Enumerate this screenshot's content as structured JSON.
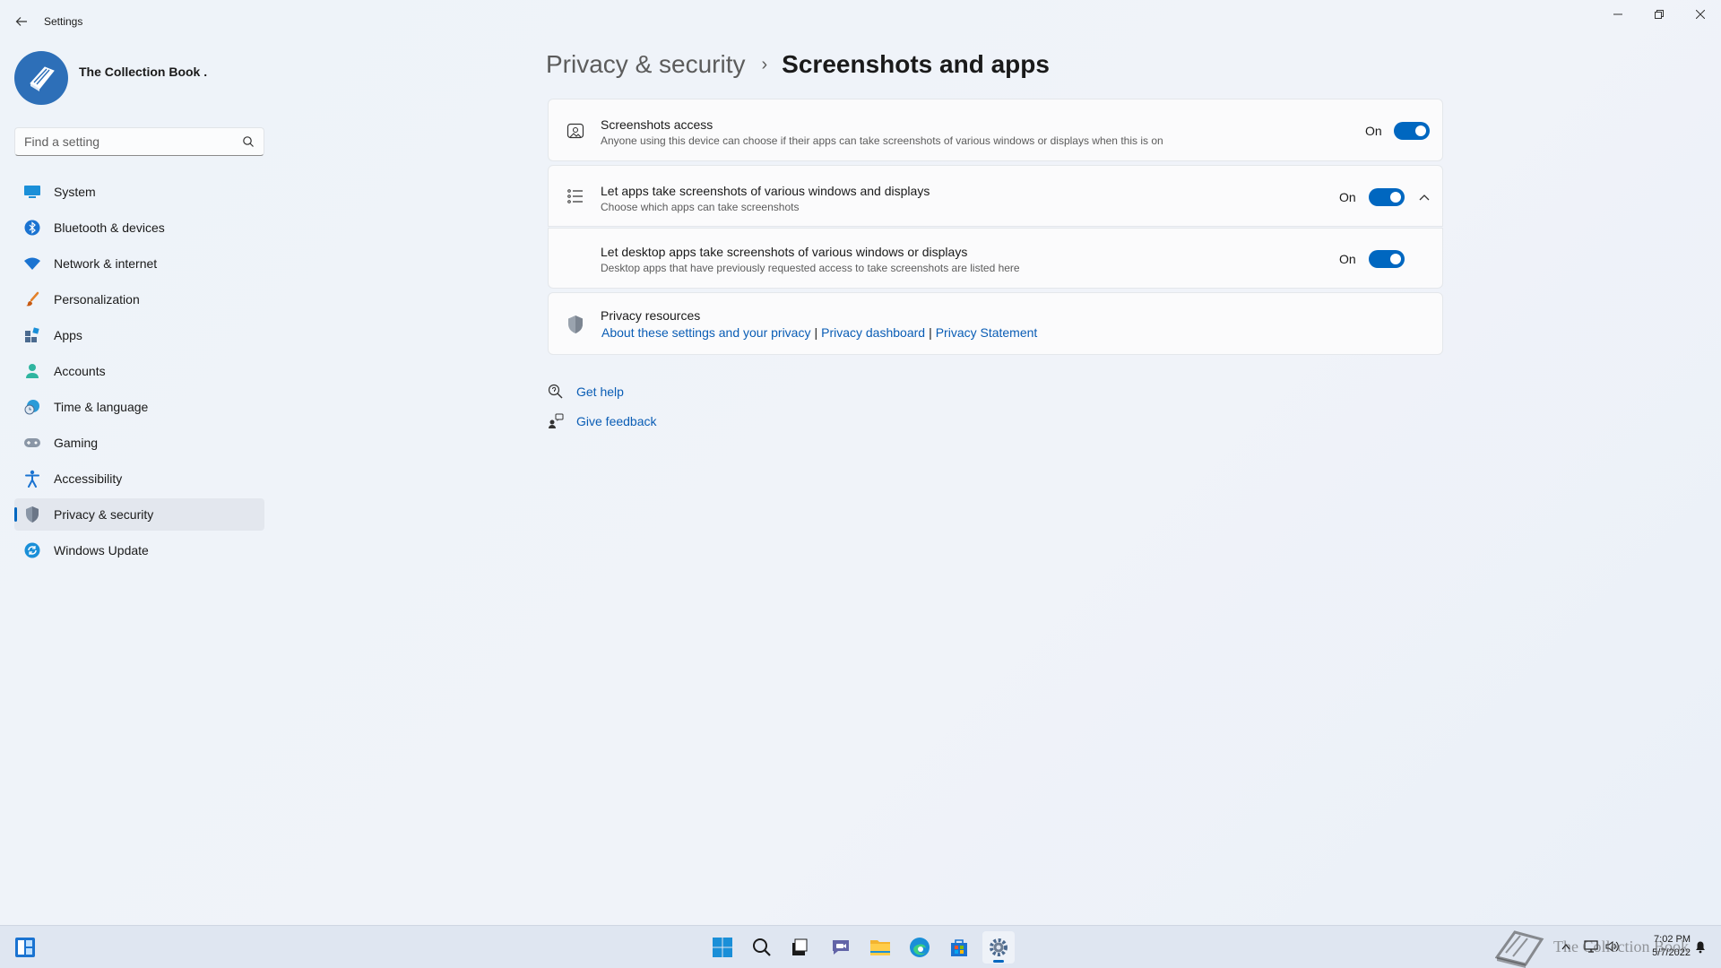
{
  "window": {
    "title": "Settings",
    "controls": {
      "minimize": "minimize",
      "maximize": "restore",
      "close": "close"
    }
  },
  "profile": {
    "name": "The Collection Book ."
  },
  "search": {
    "placeholder": "Find a setting"
  },
  "sidebar": {
    "items": [
      {
        "label": "System",
        "icon": "system-icon",
        "active": false
      },
      {
        "label": "Bluetooth & devices",
        "icon": "bluetooth-icon",
        "active": false
      },
      {
        "label": "Network & internet",
        "icon": "wifi-icon",
        "active": false
      },
      {
        "label": "Personalization",
        "icon": "brush-icon",
        "active": false
      },
      {
        "label": "Apps",
        "icon": "apps-icon",
        "active": false
      },
      {
        "label": "Accounts",
        "icon": "person-icon",
        "active": false
      },
      {
        "label": "Time & language",
        "icon": "globe-clock-icon",
        "active": false
      },
      {
        "label": "Gaming",
        "icon": "gamepad-icon",
        "active": false
      },
      {
        "label": "Accessibility",
        "icon": "accessibility-icon",
        "active": false
      },
      {
        "label": "Privacy & security",
        "icon": "shield-icon",
        "active": true
      },
      {
        "label": "Windows Update",
        "icon": "update-icon",
        "active": false
      }
    ]
  },
  "header": {
    "parent": "Privacy & security",
    "separator": "›",
    "current": "Screenshots and apps"
  },
  "settings": {
    "screenshots_access": {
      "title": "Screenshots access",
      "description": "Anyone using this device can choose if their apps can take screenshots of various windows or displays when this is on",
      "state": "On",
      "enabled": true
    },
    "let_apps": {
      "title": "Let apps take screenshots of various windows and displays",
      "description": "Choose which apps can take screenshots",
      "state": "On",
      "enabled": true,
      "expanded": true
    },
    "desktop_apps": {
      "title": "Let desktop apps take screenshots of various windows or displays",
      "description": "Desktop apps that have previously requested access to take screenshots are listed here",
      "state": "On",
      "enabled": true
    }
  },
  "privacy_resources": {
    "title": "Privacy resources",
    "links": [
      "About these settings and your privacy",
      "Privacy dashboard",
      "Privacy Statement"
    ],
    "separator": "|"
  },
  "help": {
    "get_help": "Get help",
    "give_feedback": "Give feedback"
  },
  "taskbar": {
    "apps": [
      "start-icon",
      "search-icon",
      "task-view-icon",
      "teams-chat-icon",
      "file-explorer-icon",
      "edge-icon",
      "store-icon",
      "settings-icon"
    ],
    "clock": {
      "time": "7:02 PM",
      "date": "5/7/2022"
    }
  },
  "watermark": {
    "text": "The Collection Book"
  },
  "colors": {
    "accent": "#0067c0",
    "link": "#0a5db5",
    "background": "#eef2f8"
  }
}
